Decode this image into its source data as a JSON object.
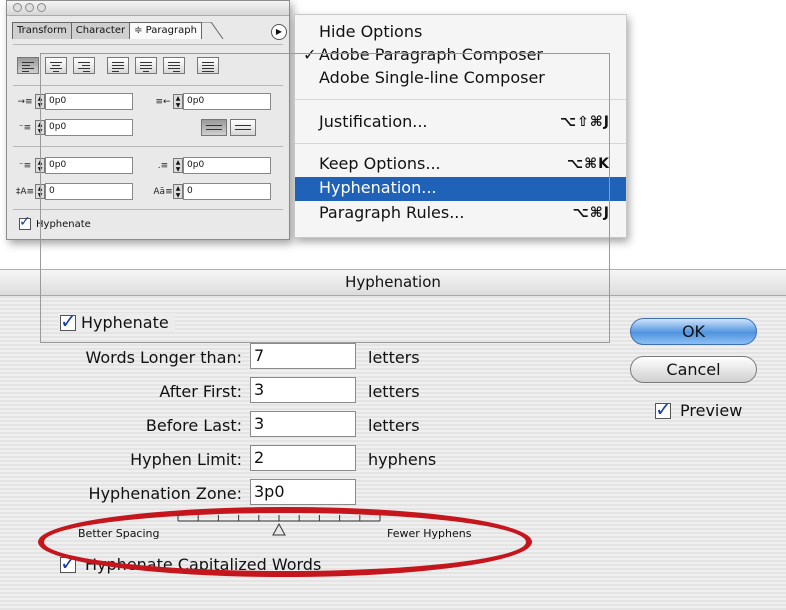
{
  "palette": {
    "tabs": [
      "Transform",
      "Character",
      "≑ Paragraph"
    ],
    "fields": {
      "left_indent": "0p0",
      "right_indent": "0p0",
      "first_line_indent": "0p0",
      "space_before": "0p0",
      "space_after": "0p0",
      "drop_cap_lines": "0",
      "drop_cap_chars": "0"
    },
    "hyphenate_label": "Hyphenate"
  },
  "menu": {
    "items": {
      "hide_options": "Hide Options",
      "adobe_paragraph_composer": "Adobe Paragraph Composer",
      "adobe_single_line_composer": "Adobe Single-line Composer",
      "justification": "Justification...",
      "justification_shortcut": "⌥⇧⌘J",
      "keep_options": "Keep Options...",
      "keep_options_shortcut": "⌥⌘K",
      "hyphenation": "Hyphenation...",
      "paragraph_rules": "Paragraph Rules...",
      "paragraph_rules_shortcut": "⌥⌘J"
    },
    "checkmark": "✓",
    "highlight_color": "#1f62b8"
  },
  "dialog": {
    "title": "Hyphenation",
    "hyphenate_label": "Hyphenate",
    "words_longer_label": "Words Longer than:",
    "words_longer_value": "7",
    "words_longer_unit": "letters",
    "after_first_label": "After First:",
    "after_first_value": "3",
    "after_first_unit": "letters",
    "before_last_label": "Before Last:",
    "before_last_value": "3",
    "before_last_unit": "letters",
    "hyphen_limit_label": "Hyphen Limit:",
    "hyphen_limit_value": "2",
    "hyphen_limit_unit": "hyphens",
    "zone_label": "Hyphenation Zone:",
    "zone_value": "3p0",
    "slider_left_label": "Better Spacing",
    "slider_right_label": "Fewer Hyphens",
    "slider_position": 0.5,
    "capitalized_label": "Hyphenate Capitalized Words",
    "ok_label": "OK",
    "cancel_label": "Cancel",
    "preview_label": "Preview",
    "annotation_color": "#c4161c"
  }
}
